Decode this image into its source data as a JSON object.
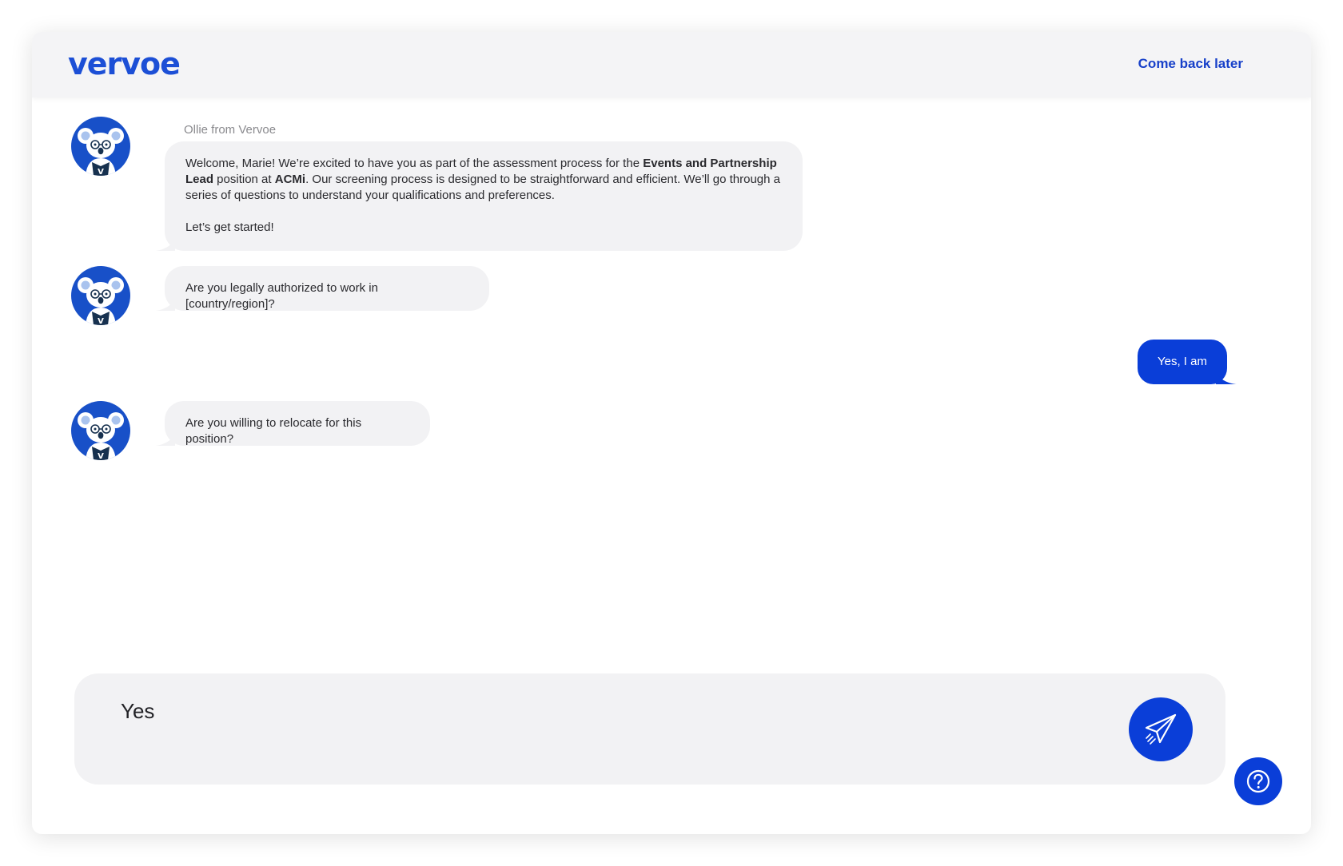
{
  "header": {
    "logo_text": "vervoe",
    "come_back_label": "Come back later"
  },
  "chat": {
    "sender_name": "Ollie from Vervoe",
    "welcome": {
      "part1": "Welcome, Marie! We’re excited to have you as part of the assessment process for the ",
      "role": "Events and Partnership Lead",
      "part2": " position at ",
      "company": "ACMi",
      "part3": ". Our screening process is designed to be straightforward and efficient. We’ll go through a series of questions to understand your qualifications and preferences.",
      "closing": "Let’s get started!"
    },
    "question_1": "Are you legally authorized to work in [country/region]?",
    "user_reply_1": "Yes, I am",
    "question_2": "Are you willing to relocate for this position?"
  },
  "composer": {
    "value": "Yes"
  },
  "icons": {
    "avatar": "koala-avatar-icon",
    "send": "paper-plane-icon",
    "help": "question-mark-icon"
  },
  "colors": {
    "brand_blue": "#1c4fd6",
    "accent_blue": "#0a3ed8",
    "bubble_gray": "#f2f2f4",
    "header_bg": "#f4f4f6"
  }
}
